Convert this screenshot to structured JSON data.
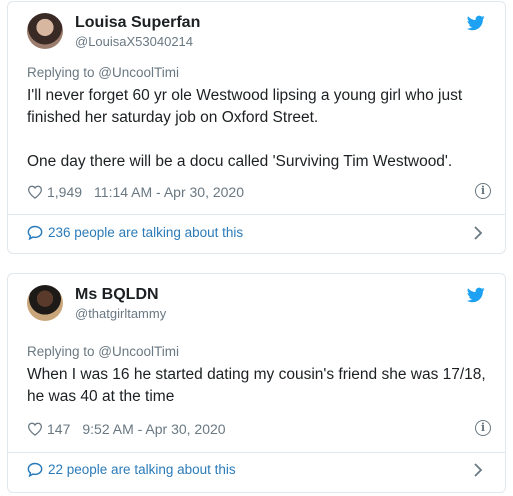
{
  "tweets": [
    {
      "name": "Louisa Superfan",
      "handle": "@LouisaX53040214",
      "replying": "Replying to @UncoolTimi",
      "text_p1": "I'll never forget 60 yr ole Westwood lipsing a young girl who just finished her saturday job on Oxford Street.",
      "text_p2": "One day there will be a docu called 'Surviving Tim Westwood'.",
      "likes": "1,949",
      "timestamp": "11:14 AM - Apr 30, 2020",
      "talking": "236 people are talking about this"
    },
    {
      "name": "Ms BQLDN",
      "handle": "@thatgirltammy",
      "replying": "Replying to @UncoolTimi",
      "text_p1": "When I was 16 he started dating my cousin's friend she was 17/18, he was 40 at the time",
      "likes": "147",
      "timestamp": "9:52 AM - Apr 30, 2020",
      "talking": "22 people are talking about this"
    }
  ],
  "icons": {
    "brand": "twitter-bird-icon",
    "like": "heart-icon",
    "info": "info-icon",
    "conversation": "speech-bubble-icon",
    "more": "chevron-right-icon"
  },
  "colors": {
    "twitter_blue": "#1da1f2",
    "link_blue": "#2b7bb9",
    "muted": "#697882",
    "text": "#1c2022",
    "border": "#e1e8ed"
  }
}
